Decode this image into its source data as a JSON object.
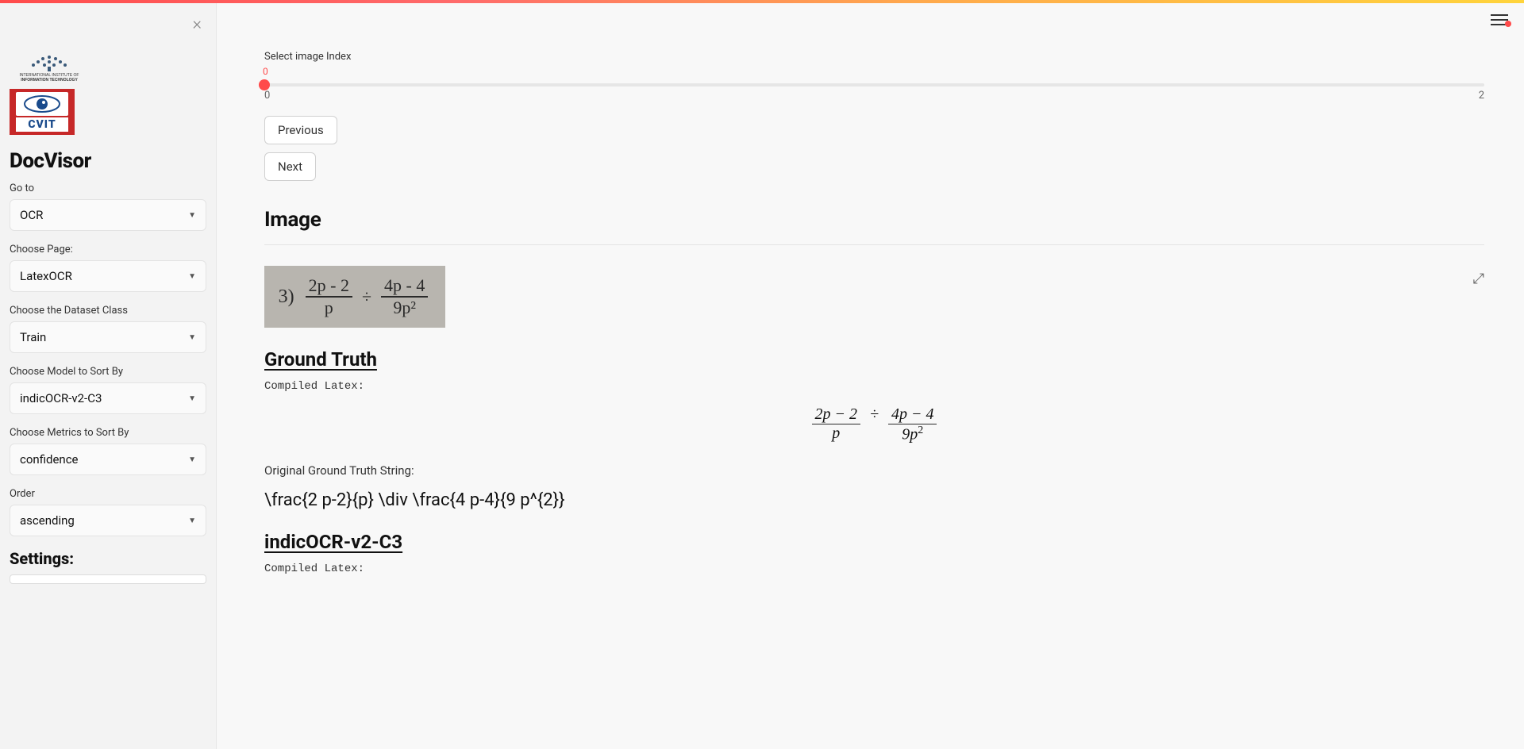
{
  "app": {
    "title": "DocVisor"
  },
  "sidebar": {
    "logo_iiit_text_top": "INTERNATIONAL INSTITUTE OF",
    "logo_iiit_text_bot": "INFORMATION TECHNOLOGY",
    "logo_cvit_text": "CVIT",
    "goto": {
      "label": "Go to",
      "value": "OCR"
    },
    "page": {
      "label": "Choose Page:",
      "value": "LatexOCR"
    },
    "dataset": {
      "label": "Choose the Dataset Class",
      "value": "Train"
    },
    "model": {
      "label": "Choose Model to Sort By",
      "value": "indicOCR-v2-C3"
    },
    "metric": {
      "label": "Choose Metrics to Sort By",
      "value": "confidence"
    },
    "order": {
      "label": "Order",
      "value": "ascending"
    },
    "settings_head": "Settings:"
  },
  "main": {
    "slider": {
      "label": "Select image Index",
      "value": "0",
      "min": "0",
      "max": "2"
    },
    "prev_label": "Previous",
    "next_label": "Next",
    "image_head": "Image",
    "gt_head": "Ground Truth",
    "compiled_label": "Compiled Latex:",
    "gt_string_label": "Original Ground Truth String:",
    "gt_string": "\\frac{2 p-2}{p} \\div \\frac{4 p-4}{9 p^{2}}",
    "model_head": "indicOCR-v2-C3",
    "compiled_label2": "Compiled Latex:",
    "src_eq": {
      "qnum": "3)",
      "f1_num": "2p - 2",
      "f1_den": "p",
      "op": "÷",
      "f2_num": "4p - 4",
      "f2_den": "9p²"
    },
    "render_eq": {
      "f1_num": "2p − 2",
      "f1_den": "p",
      "op": "÷",
      "f2_num": "4p − 4",
      "f2_den_base": "9p",
      "f2_den_sup": "2"
    }
  }
}
